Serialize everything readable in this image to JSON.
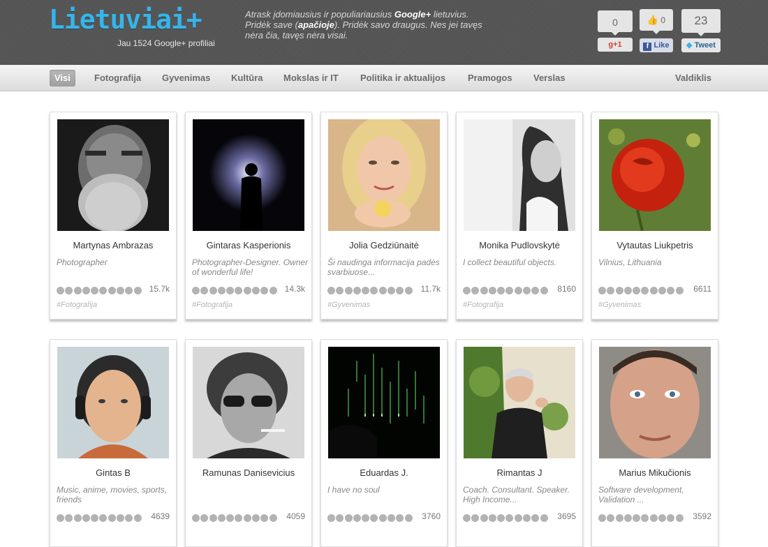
{
  "header": {
    "logo": "Lietuviai+",
    "profile_count": "Jau 1524 Google+ profiliai",
    "tagline": {
      "part1": "Atrask įdomiausius ir populiariausius ",
      "brand": "Google+",
      "part2": " lietuvius. Pridėk save (",
      "emph": "apačioje",
      "part3": "). Pridėk savo draugus. Nes jei tavęs nėra čia, tavęs nėra visai."
    },
    "share": {
      "gplus_count": "0",
      "gplus_label": "+1",
      "like_count": "0",
      "like_label": "Like",
      "tweet_count": "23",
      "tweet_label": "Tweet"
    }
  },
  "nav": {
    "items": [
      "Visi",
      "Fotografija",
      "Gyvenimas",
      "Kultūra",
      "Mokslas ir IT",
      "Politika ir aktualijos",
      "Pramogos",
      "Verslas"
    ],
    "active": "Visi",
    "right": "Valdiklis"
  },
  "profiles": [
    {
      "name": "Martynas Ambrazas",
      "desc": "Photographer",
      "count": "15.7k",
      "tag": "#Fotografija",
      "photo": "bearded-man-bw"
    },
    {
      "name": "Gintaras Kasperionis",
      "desc": "Photographer-Designer. Owner of wonderful life!",
      "count": "14.3k",
      "tag": "#Fotografija",
      "photo": "silhouette-light"
    },
    {
      "name": "Jolia Gedziūnaitė",
      "desc": "Ši naudinga informacija padės svarbiuose...",
      "count": "11.7k",
      "tag": "#Gyvenimas",
      "photo": "blonde-woman"
    },
    {
      "name": "Monika Pudlovskytė",
      "desc": "I collect beautiful objects.",
      "count": "8160",
      "tag": "#Fotografija",
      "photo": "woman-bw"
    },
    {
      "name": "Vytautas Liukpetris",
      "desc": "Vilnius, Lithuania",
      "count": "6611",
      "tag": "#Gyvenimas",
      "photo": "red-rose"
    },
    {
      "name": "Gintas B",
      "desc": "Music, anime, movies, sports, friends",
      "count": "4639",
      "tag": "",
      "photo": "young-man-headphones"
    },
    {
      "name": "Ramunas Danisevicius",
      "desc": "",
      "count": "4059",
      "tag": "",
      "photo": "man-sunglasses-bw"
    },
    {
      "name": "Eduardas J.",
      "desc": "I have no soul",
      "count": "3760",
      "tag": "",
      "photo": "matrix-code"
    },
    {
      "name": "Rimantas J",
      "desc": "Coach. Consultant. Speaker. High Income...",
      "count": "3695",
      "tag": "",
      "photo": "man-speaking"
    },
    {
      "name": "Marius Mikučionis",
      "desc": "Software development, Validation ...",
      "count": "3592",
      "tag": "",
      "photo": "man-closeup"
    }
  ],
  "colors": {
    "logo": "#35b5ea",
    "header_bg": "#555555",
    "dot": "#b3b3b3"
  }
}
